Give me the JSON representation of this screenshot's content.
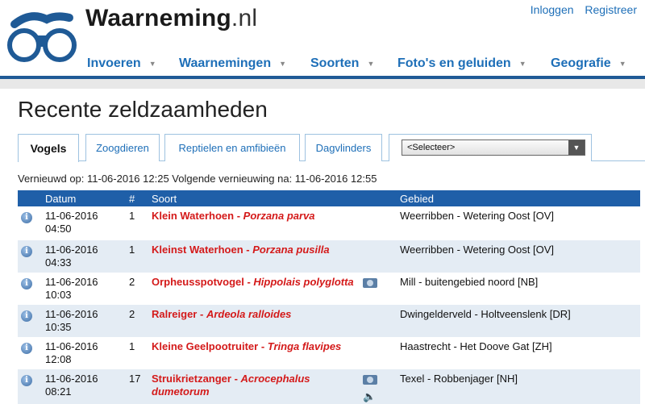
{
  "brand": {
    "name": "Waarneming",
    "tld": ".nl"
  },
  "toplinks": {
    "login": "Inloggen",
    "register": "Registreer"
  },
  "nav": [
    {
      "label": "Invoeren"
    },
    {
      "label": "Waarnemingen"
    },
    {
      "label": "Soorten"
    },
    {
      "label": "Foto's en geluiden"
    },
    {
      "label": "Geografie"
    }
  ],
  "page_title": "Recente zeldzaamheden",
  "tabs": [
    {
      "label": "Vogels",
      "active": true
    },
    {
      "label": "Zoogdieren"
    },
    {
      "label": "Reptielen en amfibieën"
    },
    {
      "label": "Dagvlinders"
    }
  ],
  "select": {
    "value": "<Selecteer>"
  },
  "updated_text": "Vernieuwd op: 11-06-2016 12:25 Volgende vernieuwing na: 11-06-2016 12:55",
  "table": {
    "headers": {
      "date": "Datum",
      "num": "#",
      "species": "Soort",
      "area": "Gebied"
    },
    "rows": [
      {
        "date": "11-06-2016",
        "time": "04:50",
        "count": "1",
        "name": "Klein Waterhoen",
        "sep": " - ",
        "latin": "Porzana parva",
        "photo": false,
        "sound": false,
        "area": "Weerribben - Wetering Oost [OV]"
      },
      {
        "date": "11-06-2016",
        "time": "04:33",
        "count": "1",
        "name": "Kleinst Waterhoen",
        "sep": " - ",
        "latin": "Porzana pusilla",
        "photo": false,
        "sound": false,
        "area": "Weerribben - Wetering Oost [OV]"
      },
      {
        "date": "11-06-2016",
        "time": "10:03",
        "count": "2",
        "name": "Orpheusspotvogel",
        "sep": " - ",
        "latin": "Hippolais polyglotta",
        "photo": true,
        "sound": false,
        "area": "Mill - buitengebied noord [NB]"
      },
      {
        "date": "11-06-2016",
        "time": "10:35",
        "count": "2",
        "name": "Ralreiger",
        "sep": " - ",
        "latin": "Ardeola ralloides",
        "photo": false,
        "sound": false,
        "area": "Dwingelderveld - Holtveenslenk [DR]"
      },
      {
        "date": "11-06-2016",
        "time": "12:08",
        "count": "1",
        "name": "Kleine Geelpootruiter",
        "sep": " - ",
        "latin": "Tringa flavipes",
        "photo": false,
        "sound": false,
        "area": "Haastrecht - Het Doove Gat [ZH]"
      },
      {
        "date": "11-06-2016",
        "time": "08:21",
        "count": "17",
        "name": "Struikrietzanger",
        "sep": " - ",
        "latin": "Acrocephalus dumetorum",
        "photo": true,
        "sound": true,
        "area": "Texel - Robbenjager [NH]"
      }
    ]
  },
  "icons": {
    "info": "info-icon",
    "photo": "camera-icon",
    "sound": "speaker-icon",
    "logo": "binoculars-icon"
  },
  "colors": {
    "accent": "#1f5fa8",
    "species": "#d41a1a",
    "link": "#1e6fb8"
  }
}
